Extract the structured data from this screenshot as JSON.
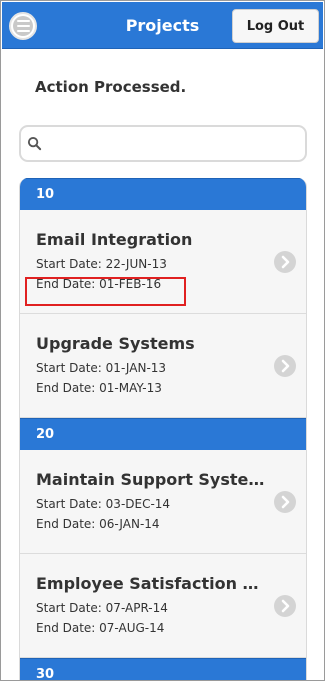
{
  "header": {
    "title": "Projects",
    "logout_label": "Log Out"
  },
  "message": "Action Processed.",
  "search": {
    "value": "",
    "placeholder": ""
  },
  "groups": [
    {
      "label": "10",
      "items": [
        {
          "name": "Email Integration",
          "start": "Start Date: 22-JUN-13",
          "end": "End Date: 01-FEB-16"
        },
        {
          "name": "Upgrade Systems",
          "start": "Start Date: 01-JAN-13",
          "end": "End Date: 01-MAY-13"
        }
      ]
    },
    {
      "label": "20",
      "items": [
        {
          "name": "Maintain Support Systems",
          "start": "Start Date: 03-DEC-14",
          "end": "End Date: 06-JAN-14"
        },
        {
          "name": "Employee Satisfaction Survey",
          "start": "Start Date: 07-APR-14",
          "end": "End Date: 07-AUG-14"
        }
      ]
    },
    {
      "label": "30",
      "items": []
    }
  ],
  "colors": {
    "accent": "#2a78d6",
    "highlight": "#e02020"
  }
}
